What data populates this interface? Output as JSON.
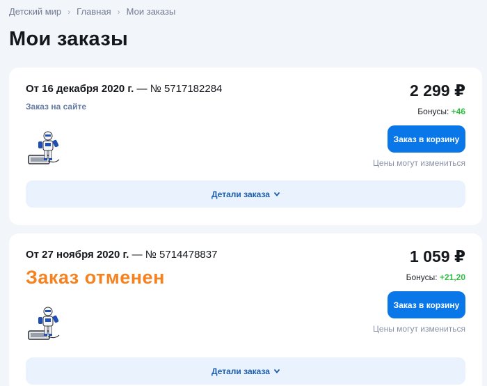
{
  "breadcrumb": [
    "Детский мир",
    "Главная",
    "Мои заказы"
  ],
  "page_title": "Мои заказы",
  "orders": [
    {
      "date": "От 16 декабря 2020 г.",
      "number": "— № 5717182284",
      "source": "Заказ на сайте",
      "status": "",
      "price": "2 299 ₽",
      "bonus_label": "Бонусы:",
      "bonus_value": "+46",
      "cart_button": "Заказ в корзину",
      "price_note": "Цены могут измениться",
      "details_label": "Детали заказа"
    },
    {
      "date": "От 27 ноября 2020 г.",
      "number": "— № 5714478837",
      "source": "",
      "status": "Заказ отменен",
      "price": "1 059 ₽",
      "bonus_label": "Бонусы:",
      "bonus_value": "+21,20",
      "cart_button": "Заказ в корзину",
      "price_note": "Цены могут измениться",
      "details_label": "Детали заказа"
    }
  ],
  "colors": {
    "accent_button": "#0a77e8",
    "bonus_green": "#2dbd40",
    "cancel_orange": "#f6821f",
    "details_bg": "#eaf2fd"
  },
  "icons": [
    "chevron-right-icon",
    "chevron-down-icon",
    "robot-toy-product-image"
  ]
}
